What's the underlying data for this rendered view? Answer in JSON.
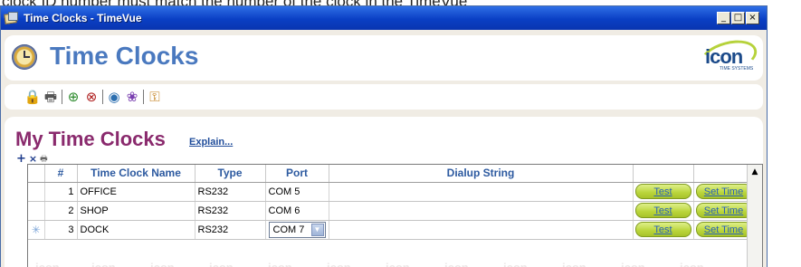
{
  "caption": "clock ID number must match the number of the clock in the TimeVue",
  "window": {
    "title": "Time Clocks - TimeVue",
    "controls": {
      "minimize": "_",
      "maximize": "□",
      "close": "×"
    }
  },
  "header": {
    "title": "Time Clocks",
    "logo_text": "icon",
    "logo_subtext": "TIME SYSTEMS"
  },
  "toolbar": {
    "icons": [
      "lock-icon",
      "print-icon",
      "add-clock-icon",
      "delete-clock-icon",
      "poll-clock-icon",
      "clock-settings-icon",
      "keys-icon"
    ]
  },
  "panel": {
    "title": "My Time Clocks",
    "explain_link": "Explain..."
  },
  "grid": {
    "watermark": "icon",
    "columns": [
      "#",
      "Time Clock Name",
      "Type",
      "Port",
      "Dialup String",
      "",
      ""
    ],
    "rows": [
      {
        "selector": "",
        "number": "1",
        "name": "OFFICE",
        "type": "RS232",
        "port": "COM 5",
        "dialup": "",
        "test": "Test",
        "set_time": "Set Time"
      },
      {
        "selector": "",
        "number": "2",
        "name": "SHOP",
        "type": "RS232",
        "port": "COM 6",
        "dialup": "",
        "test": "Test",
        "set_time": "Set Time"
      },
      {
        "selector": "✳",
        "number": "3",
        "name": "DOCK",
        "type": "RS232",
        "port": "COM 7",
        "dialup": "",
        "test": "Test",
        "set_time": "Set Time"
      }
    ]
  }
}
